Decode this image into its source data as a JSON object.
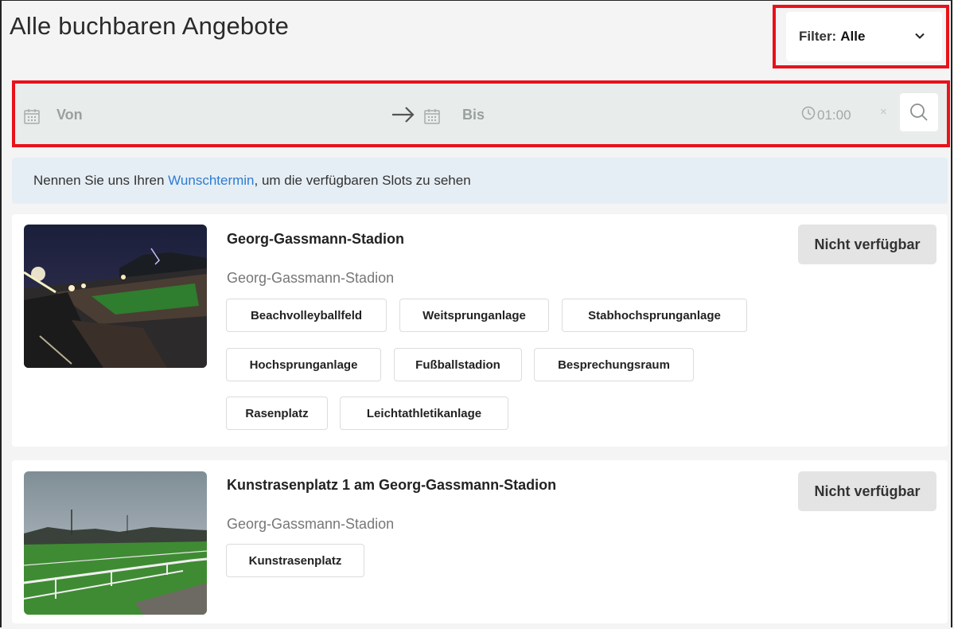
{
  "page": {
    "title": "Alle buchbaren Angebote"
  },
  "filter": {
    "label": "Filter:",
    "value": "Alle",
    "icon": "chevron-down-icon"
  },
  "search": {
    "from_placeholder": "Von",
    "to_placeholder": "Bis",
    "time": "01:00",
    "clear_symbol": "×",
    "icons": [
      "calendar-icon",
      "arrow-right-icon",
      "clock-icon",
      "search-icon"
    ]
  },
  "info": {
    "before": "Nennen Sie uns Ihren ",
    "link": "Wunschtermin",
    "after": ", um die verfügbaren Slots zu sehen"
  },
  "offers": [
    {
      "title": "Georg-Gassmann-Stadion",
      "location": "Georg-Gassmann-Stadion",
      "status": "Nicht verfügbar",
      "tags": [
        "Beachvolleyballfeld",
        "Weitsprunganlage",
        "Stabhochsprunganlage",
        "Hochsprunganlage",
        "Fußballstadion",
        "Besprechungsraum",
        "Rasenplatz",
        "Leichtathletikanlage"
      ]
    },
    {
      "title": "Kunstrasenplatz 1 am Georg-Gassmann-Stadion",
      "location": "Georg-Gassmann-Stadion",
      "status": "Nicht verfügbar",
      "tags": [
        "Kunstrasenplatz"
      ]
    }
  ],
  "colors": {
    "highlight": "#e8121a",
    "link": "#2b7cd3",
    "info_bg": "#e6eef5"
  }
}
